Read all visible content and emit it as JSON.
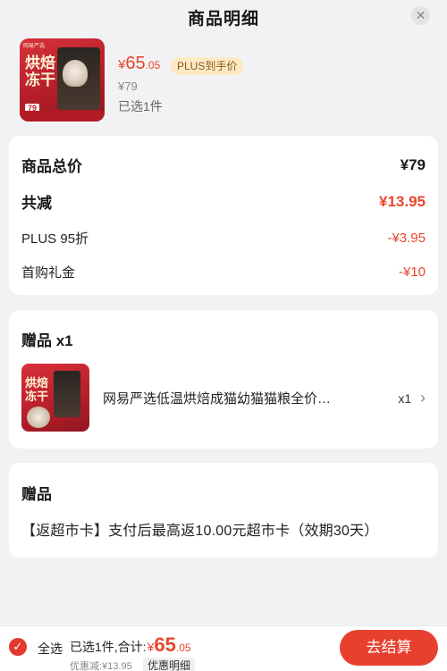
{
  "header": {
    "title": "商品明细",
    "close_glyph": "✕"
  },
  "product": {
    "thumb_brand": "网易严选",
    "thumb_title": "烘焙冻干",
    "thumb_badge": "79",
    "currency": "¥",
    "price_int": "65",
    "price_dec": ".05",
    "plus_tag": "PLUS到手价",
    "original_price": "¥79",
    "selected_qty": "已选1件"
  },
  "summary": {
    "total_label": "商品总价",
    "total_value": "¥79",
    "reduce_label": "共减",
    "reduce_value": "¥13.95",
    "plus_label": "PLUS 95折",
    "plus_value": "-¥3.95",
    "gift_money_label": "首购礼金",
    "gift_money_value": "-¥10"
  },
  "gift_item": {
    "section_title": "赠品 x1",
    "thumb_title": "烘焙冻干",
    "name": "网易严选低温烘焙成猫幼猫猫粮全价…",
    "qty": "x1",
    "chevron": "›"
  },
  "gift_coupon": {
    "section_title": "赠品",
    "text": "【返超市卡】支付后最高返10.00元超市卡（效期30天）"
  },
  "bottom": {
    "check_glyph": "✓",
    "select_all": "全选",
    "sum_label": "已选1件,合计:",
    "currency": "¥",
    "sum_int": "65",
    "sum_dec": ".05",
    "discount": "优惠减:¥13.95",
    "detail_link": "优惠明细",
    "checkout": "去结算"
  },
  "colors": {
    "accent": "#e8462d",
    "plus_tag_bg": "#fde9c3",
    "page_bg": "#f2f2f4"
  }
}
